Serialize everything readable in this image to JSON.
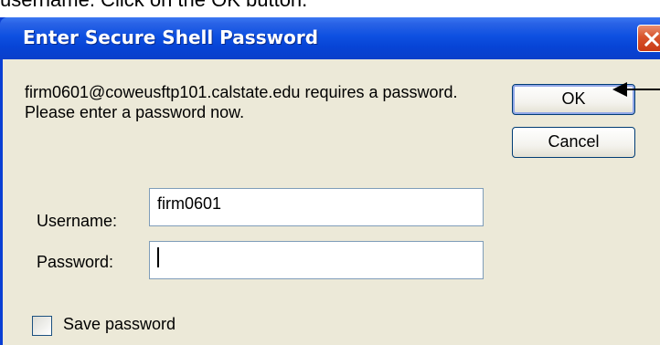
{
  "caption": "username. Click on the OK button.",
  "dialog": {
    "title": "Enter Secure Shell Password",
    "message": "firm0601@coweusftp101.calstate.edu requires a password.  Please enter a password now.",
    "ok_label": "OK",
    "cancel_label": "Cancel",
    "username_label": "Username:",
    "username_value": "firm0601",
    "password_label": "Password:",
    "password_value": "",
    "save_password_label": "Save password",
    "save_password_checked": false
  },
  "colors": {
    "titlebar": "#0a49d8",
    "client": "#ece9d8",
    "close_button": "#d8532c"
  }
}
